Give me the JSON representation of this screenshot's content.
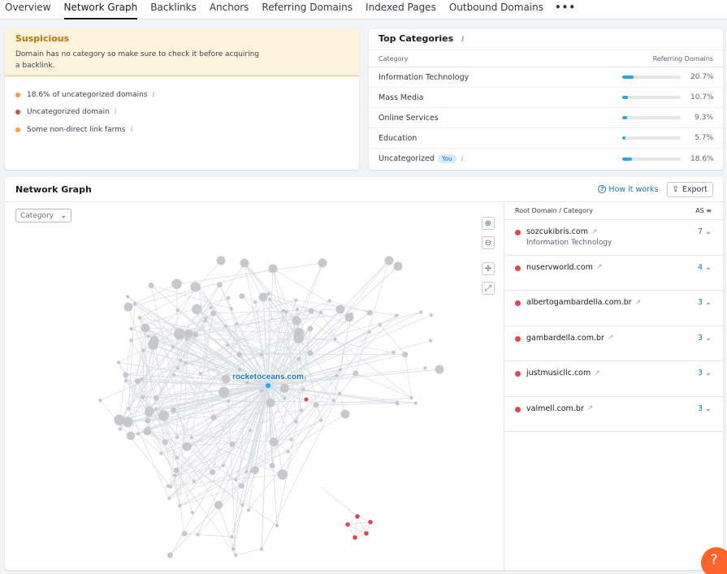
{
  "tabs": [
    {
      "label": "Overview",
      "active": false
    },
    {
      "label": "Network Graph",
      "active": true
    },
    {
      "label": "Backlinks",
      "active": false
    },
    {
      "label": "Anchors",
      "active": false
    },
    {
      "label": "Referring Domains",
      "active": false
    },
    {
      "label": "Indexed Pages",
      "active": false
    },
    {
      "label": "Outbound Domains",
      "active": false
    }
  ],
  "more_label": "•••",
  "suspicious": {
    "title": "Suspicious",
    "message": "Domain has no category so make sure to check it before acquiring a backlink.",
    "items": [
      {
        "text": "18.6% of uncategorized domains",
        "color": "#f0a040"
      },
      {
        "text": "Uncategorized domain",
        "color": "#e0474c"
      },
      {
        "text": "Some non-direct link farms",
        "color": "#f0a040"
      }
    ]
  },
  "top_categories": {
    "title": "Top Categories",
    "col_category": "Category",
    "col_domains": "Referring Domains",
    "rows": [
      {
        "name": "Information Technology",
        "percent": 20.7,
        "label": "20.7%"
      },
      {
        "name": "Mass Media",
        "percent": 10.7,
        "label": "10.7%"
      },
      {
        "name": "Online Services",
        "percent": 9.3,
        "label": "9.3%"
      },
      {
        "name": "Education",
        "percent": 5.7,
        "label": "5.7%"
      },
      {
        "name": "Uncategorized",
        "percent": 18.6,
        "label": "18.6%",
        "badge": "You"
      }
    ],
    "bar_color": "#2fa3dd"
  },
  "network": {
    "title": "Network Graph",
    "how_it_works": "How it works",
    "export": "Export",
    "category_select": "Category",
    "center_label": "rocketoceans.com",
    "colors": {
      "node": "#c6c8cd",
      "edge": "#d9dce2",
      "center": "#2fa3dd",
      "suspicious": "#e0474c",
      "label": "#1b76c4"
    }
  },
  "side_list": {
    "col_domain": "Root Domain / Category",
    "col_as": "AS",
    "rows": [
      {
        "domain": "sozcukibris.com",
        "category": "Information Technology",
        "as": "7"
      },
      {
        "domain": "nuservworld.com",
        "category": "",
        "as": "4"
      },
      {
        "domain": "albertogambardella.com.br",
        "category": "",
        "as": "3"
      },
      {
        "domain": "gambardella.com.br",
        "category": "",
        "as": "3"
      },
      {
        "domain": "justmusicllc.com",
        "category": "",
        "as": "3"
      },
      {
        "domain": "valmell.com.br",
        "category": "",
        "as": "3"
      }
    ]
  },
  "help_label": "?"
}
